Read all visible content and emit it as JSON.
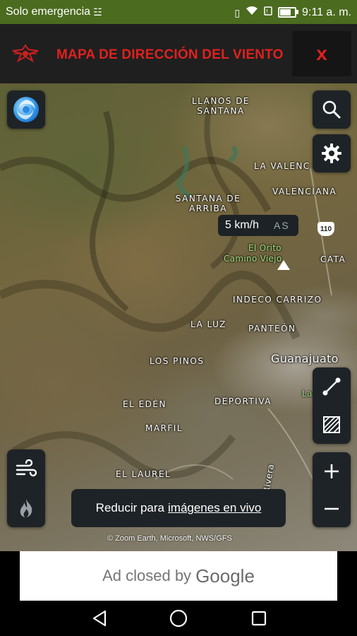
{
  "status_bar": {
    "carrier": "Solo emergencia",
    "time": "9:11 a. m.",
    "battery_level": 0.85
  },
  "header": {
    "title": "MAPA DE DIRECCIÓN DEL VIENTO",
    "close_label": "x"
  },
  "map": {
    "places": {
      "llanos": "LLANOS DE SANTANA",
      "valenc_la": "LA VALENC",
      "valenciana": "VALENCIANA",
      "santana_arriba": "SANTANA DE ARRIBA",
      "orito": "El Orito",
      "camino_viejo": "Camino Viejo",
      "cata": "CATA",
      "indeco": "INDECO CARRIZO",
      "la_luz": "LA LUZ",
      "panteon": "PANTEÓN",
      "los_pinos": "LOS PINOS",
      "guanajuato": "Guanajuato",
      "la_small": "La",
      "el_eden": "EL EDÉN",
      "deportiva": "DEPORTIVA",
      "marfil": "MARFIL",
      "el_laurel": "EL LAUREL",
      "rivera": "Rivera"
    },
    "highway_shield": "110",
    "wind_speed": "5 km/h",
    "wind_direction": "AS",
    "live_banner_prefix": "Reducir para",
    "live_banner_link": "imágenes en vivo",
    "attribution": "© Zoom Earth, Microsoft, NWS/GFS"
  },
  "ad": {
    "text": "Ad closed by",
    "brand": "Google"
  },
  "colors": {
    "status_bar": "#4b6b1f",
    "title_red": "#e0211f",
    "header_bg": "#1f1f1f",
    "button_bg": "#1e2327"
  }
}
